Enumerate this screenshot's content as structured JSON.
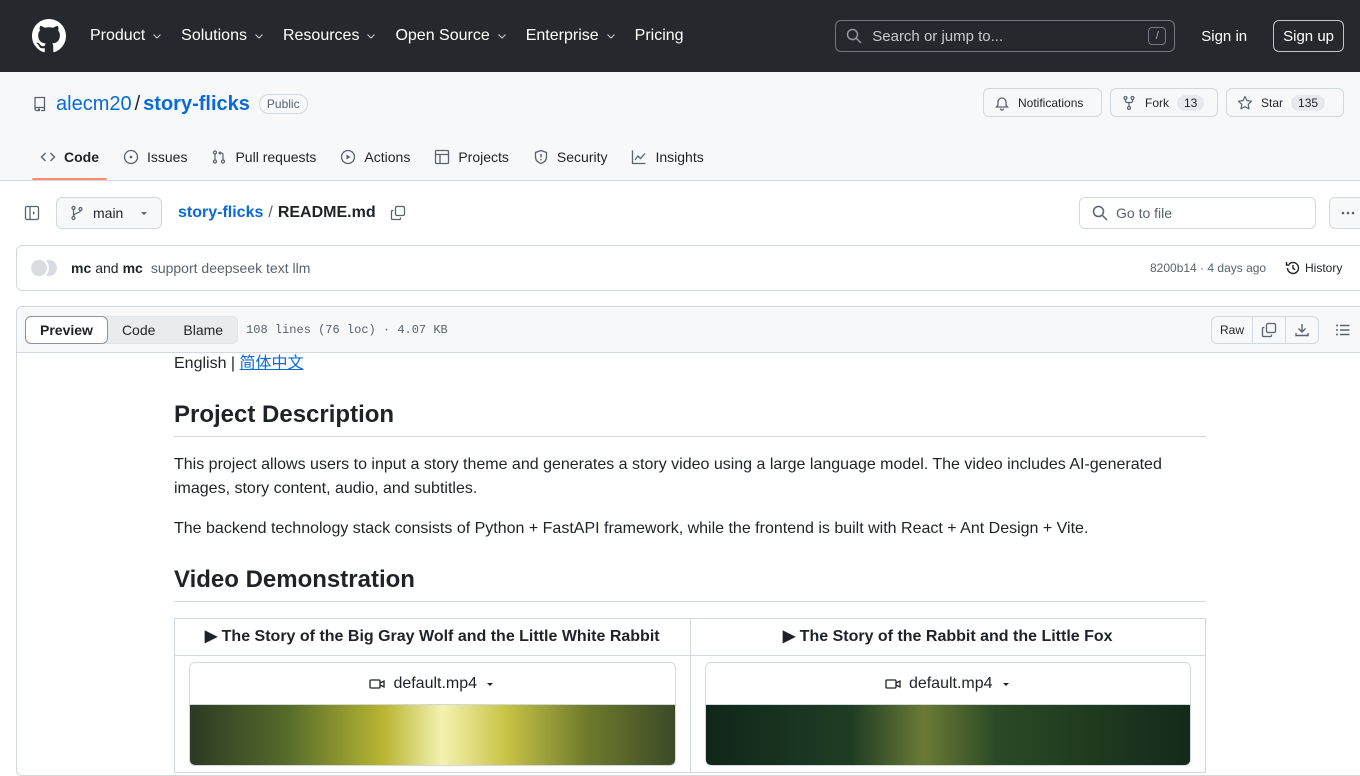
{
  "header": {
    "nav": [
      {
        "label": "Product",
        "has_dropdown": true
      },
      {
        "label": "Solutions",
        "has_dropdown": true
      },
      {
        "label": "Resources",
        "has_dropdown": true
      },
      {
        "label": "Open Source",
        "has_dropdown": true
      },
      {
        "label": "Enterprise",
        "has_dropdown": true
      },
      {
        "label": "Pricing",
        "has_dropdown": false
      }
    ],
    "search_placeholder": "Search or jump to...",
    "search_shortcut": "/",
    "sign_in": "Sign in",
    "sign_up": "Sign up"
  },
  "repo": {
    "owner": "alecm20",
    "separator": "/",
    "name": "story-flicks",
    "visibility": "Public",
    "notifications_label": "Notifications",
    "fork_label": "Fork",
    "fork_count": "13",
    "star_label": "Star",
    "star_count": "135",
    "tabs": [
      {
        "label": "Code",
        "icon": "code-icon",
        "active": true
      },
      {
        "label": "Issues",
        "icon": "issue-icon"
      },
      {
        "label": "Pull requests",
        "icon": "pull-request-icon"
      },
      {
        "label": "Actions",
        "icon": "play-icon"
      },
      {
        "label": "Projects",
        "icon": "table-icon"
      },
      {
        "label": "Security",
        "icon": "shield-icon"
      },
      {
        "label": "Insights",
        "icon": "graph-icon"
      }
    ]
  },
  "file": {
    "branch": "main",
    "repo_crumb": "story-flicks",
    "crumb_sep": "/",
    "filename": "README.md",
    "goto_placeholder": "Go to file",
    "commit": {
      "author1": "mc",
      "and": "and",
      "author2": "mc",
      "message": "support deepseek text llm",
      "meta": "8200b14 · 4 days ago",
      "history": "History"
    },
    "view_tabs": {
      "preview": "Preview",
      "code": "Code",
      "blame": "Blame"
    },
    "info": "108 lines (76 loc) · 4.07 KB",
    "raw": "Raw"
  },
  "readme": {
    "lang_english": "English",
    "lang_sep": " | ",
    "lang_chinese": "简体中文",
    "h_project": "Project Description",
    "p1": "This project allows users to input a story theme and generates a story video using a large language model. The video includes AI-generated images, story content, audio, and subtitles.",
    "p2": "The backend technology stack consists of Python + FastAPI framework, while the frontend is built with React + Ant Design + Vite.",
    "h_video": "Video Demonstration",
    "videos": [
      {
        "title": "▶ The Story of the Big Gray Wolf and the Little White Rabbit",
        "file": "default.mp4"
      },
      {
        "title": "▶ The Story of the Rabbit and the Little Fox",
        "file": "default.mp4"
      }
    ]
  }
}
